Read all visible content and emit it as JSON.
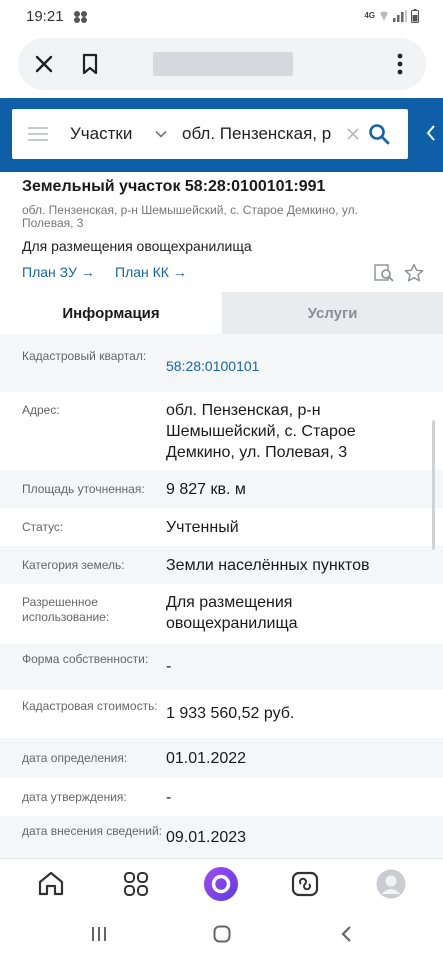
{
  "status_bar": {
    "time": "19:21",
    "network": "4G",
    "icons": [
      "multi-dot-notification-icon",
      "wifi-icon",
      "signal-icon",
      "battery-icon"
    ]
  },
  "browser": {
    "icons": [
      "close-icon",
      "bookmark-icon",
      "more-vertical-icon"
    ]
  },
  "search": {
    "type_selector": "Участки",
    "query": "обл. Пензенская, р",
    "icons": [
      "hamburger-icon",
      "chevron-down-icon",
      "clear-icon",
      "search-icon",
      "collapse-icon"
    ]
  },
  "parcel": {
    "title": "Земельный участок 58:28:0100101:991",
    "address": "обл. Пензенская, р-н Шемышейский, с. Старое Демкино, ул. Полевая, 3",
    "purpose": "Для размещения овощехранилища",
    "plan_zu": "План ЗУ →",
    "plan_kk": "План КК →"
  },
  "tabs": {
    "info": "Информация",
    "services": "Услуги"
  },
  "rows": [
    {
      "label": "Кадастровый квартал:",
      "value": "58:28:0100101",
      "link": true
    },
    {
      "label": "Адрес:",
      "value": "обл. Пензенская, р-н Шемышейский, с. Старое Демкино, ул. Полевая, 3"
    },
    {
      "label": "Площадь уточненная:",
      "value": "9 827 кв. м"
    },
    {
      "label": "Статус:",
      "value": "Учтенный"
    },
    {
      "label": "Категория земель:",
      "value": "Земли населённых пунктов"
    },
    {
      "label": "Разрешенное использование:",
      "value": "Для размещения овощехранилища"
    },
    {
      "label": "Форма собственности:",
      "value": "-"
    },
    {
      "label": "Кадастровая стоимость:",
      "value": "1 933 560,52 руб."
    },
    {
      "label": "дата определения:",
      "value": "01.01.2022"
    },
    {
      "label": "дата утверждения:",
      "value": "-"
    },
    {
      "label": "дата внесения сведений:",
      "value": "09.01.2023"
    }
  ],
  "colors": {
    "brand_blue": "#0e5ea8",
    "link_blue": "#1565a8",
    "alice_purple": "#7b3fe4"
  },
  "bottom_nav": {
    "icons": [
      "home-icon",
      "apps-grid-icon",
      "alice-assistant-icon",
      "tabs-icon",
      "profile-avatar-icon"
    ]
  },
  "system_nav": {
    "icons": [
      "recents-icon",
      "home-circle-icon",
      "back-chevron-icon"
    ]
  }
}
